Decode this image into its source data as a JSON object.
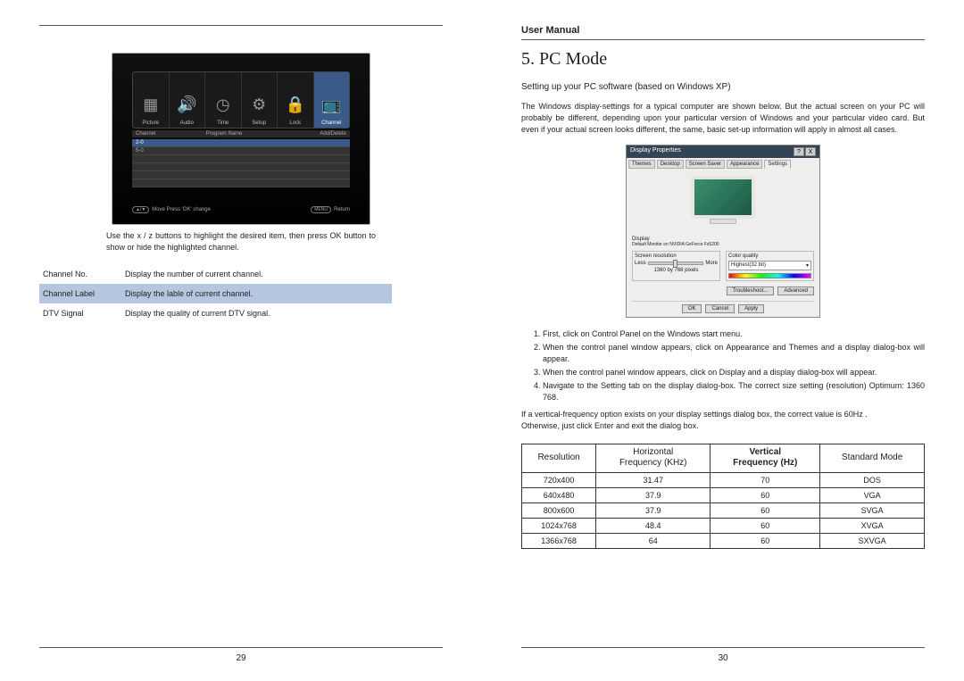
{
  "left": {
    "page_num": "29",
    "osd": {
      "tabs": [
        "Picture",
        "Audio",
        "Time",
        "Setup",
        "Lock",
        "Channel"
      ],
      "columns": [
        "Channel",
        "Program Name",
        "Add/Delete"
      ],
      "rows": [
        "2-0",
        "5-0"
      ],
      "footer_left": "Move     Press 'OK' change",
      "footer_right": "Return",
      "menu_label": "MENU"
    },
    "instruction": "Use the x / z buttons to highlight the desired item, then press OK button to show or hide the highlighted channel.",
    "defs": [
      {
        "term": "Channel No.",
        "desc": "Display the number of current channel."
      },
      {
        "term": "Channel Label",
        "desc": "Display the lable of current channel."
      },
      {
        "term": "DTV Signal",
        "desc": "Display the quality of current DTV signal."
      }
    ]
  },
  "right": {
    "page_num": "30",
    "header": "User Manual",
    "title": "5. PC Mode",
    "subhead": "Setting up your PC software (based on Windows XP)",
    "body": "The Windows display-settings for a typical computer are shown below. But the actual screen on your PC will probably be different, depending upon your particular version of Windows and your particular video card. But even if your actual screen looks different, the same, basic set-up information will apply in almost all cases.",
    "dialog": {
      "title": "Display Properties",
      "tabs": [
        "Themes",
        "Desktop",
        "Screen Saver",
        "Appearance",
        "Settings"
      ],
      "display_label": "Display",
      "display_value": "Default Monitor on NVIDIA GeForce Fx5200",
      "res_label": "Screen resolution",
      "res_less": "Less",
      "res_more": "More",
      "res_value": "1360 by 768 pixels",
      "cq_label": "Color quality",
      "cq_value": "Highest(32 bit)",
      "btn_troubleshoot": "Troubleshoot...",
      "btn_advanced": "Advanced",
      "btn_ok": "OK",
      "btn_cancel": "Cancel",
      "btn_apply": "Apply"
    },
    "steps": [
      "First, click on  Control Panel  on the Windows start menu.",
      "When the control panel window appears, click on  Appearance and Themes  and a display dialog-box will appear.",
      "When the control panel window appears, click on  Display  and a display dialog-box will appear.",
      "Navigate to the  Setting  tab on the display dialog-box. The correct size setting (resolution) Optimum: 1360  768."
    ],
    "note1": "If a vertical-frequency option exists on your display settings dialog box, the correct value is  60Hz .",
    "note2": "Otherwise, just click  Enter  and exit the dialog box.",
    "table": {
      "head": [
        "Resolution",
        "Horizontal\nFrequency (KHz)",
        "Vertical\nFrequency (Hz)",
        "Standard Mode"
      ],
      "rows": [
        [
          "720x400",
          "31.47",
          "70",
          "DOS"
        ],
        [
          "640x480",
          "37.9",
          "60",
          "VGA"
        ],
        [
          "800x600",
          "37.9",
          "60",
          "SVGA"
        ],
        [
          "1024x768",
          "48.4",
          "60",
          "XVGA"
        ],
        [
          "1366x768",
          "64",
          "60",
          "SXVGA"
        ]
      ]
    }
  },
  "chart_data": {
    "type": "table",
    "title": "PC Mode Resolution Table",
    "columns": [
      "Resolution",
      "Horizontal Frequency (KHz)",
      "Vertical Frequency (Hz)",
      "Standard Mode"
    ],
    "rows": [
      [
        "720x400",
        31.47,
        70,
        "DOS"
      ],
      [
        "640x480",
        37.9,
        60,
        "VGA"
      ],
      [
        "800x600",
        37.9,
        60,
        "SVGA"
      ],
      [
        "1024x768",
        48.4,
        60,
        "XVGA"
      ],
      [
        "1366x768",
        64,
        60,
        "SXVGA"
      ]
    ]
  }
}
